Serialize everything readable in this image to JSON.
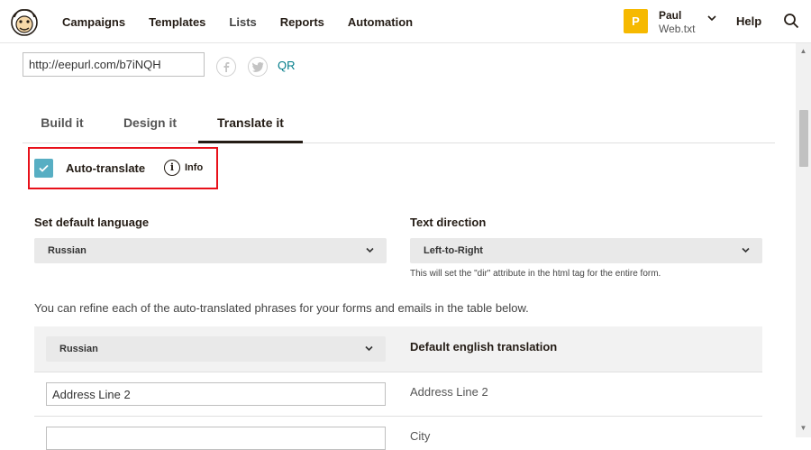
{
  "nav": {
    "items": [
      "Campaigns",
      "Templates",
      "Lists",
      "Reports",
      "Automation"
    ],
    "active": "Lists"
  },
  "user": {
    "initial": "P",
    "name": "Paul",
    "org": "Web.txt"
  },
  "help_label": "Help",
  "share": {
    "url": "http://eepurl.com/b7iNQH",
    "qr_label": "QR"
  },
  "tabs": [
    "Build it",
    "Design it",
    "Translate it"
  ],
  "active_tab": "Translate it",
  "auto_translate": {
    "label": "Auto-translate",
    "checked": true,
    "info_label": "Info",
    "info_glyph": "i"
  },
  "default_language": {
    "title": "Set default language",
    "value": "Russian"
  },
  "text_direction": {
    "title": "Text direction",
    "value": "Left-to-Right",
    "note": "This will set the \"dir\" attribute in the html tag for the entire form."
  },
  "refine_text": "You can refine each of the auto-translated phrases for your forms and emails in the table below.",
  "table": {
    "language_select": "Russian",
    "default_column_title": "Default english translation",
    "rows": [
      {
        "value": "Address Line 2",
        "default": "Address Line 2"
      },
      {
        "value": "",
        "default": "City"
      }
    ]
  },
  "colors": {
    "accent": "#007c89",
    "checkbox": "#57aec3",
    "highlight": "#e8101a",
    "avatar": "#f6b900"
  }
}
